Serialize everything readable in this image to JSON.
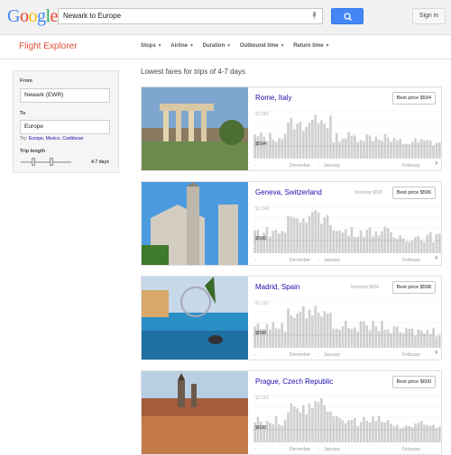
{
  "header": {
    "logo": "Google",
    "search_value": "Newark to Europe",
    "signin_label": "Sign in"
  },
  "subheader": {
    "app_title": "Flight Explorer",
    "filters": [
      "Stops",
      "Airline",
      "Duration",
      "Outbound time",
      "Return time"
    ]
  },
  "sidebar": {
    "from_label": "From",
    "from_value": "Newark (EWR)",
    "to_label": "To",
    "to_value": "Europe",
    "try_label": "Try:",
    "try_links": [
      "Europe,",
      "Mexico,",
      "Caribbean"
    ],
    "trip_length_label": "Trip length",
    "trip_length_value": "4-7 days"
  },
  "results": {
    "title": "Lowest fares for trips of 4-7 days",
    "cards": [
      {
        "city": "Rome, Italy",
        "nonstop": "",
        "best_price": "Best price $594",
        "y_max_label": "$1,882",
        "y_min_label": "$594",
        "x_labels": [
          "December",
          "January",
          "February"
        ]
      },
      {
        "city": "Geneva, Switzerland",
        "nonstop": "Nonstop $836",
        "best_price": "Best price $596",
        "y_max_label": "$1,546",
        "y_min_label": "$596",
        "x_labels": [
          "December",
          "January",
          "February"
        ]
      },
      {
        "city": "Madrid, Spain",
        "nonstop": "Nonstop $826",
        "best_price": "Best price $598",
        "y_max_label": "$2,181",
        "y_min_label": "$598",
        "x_labels": [
          "December",
          "January",
          "February"
        ]
      },
      {
        "city": "Prague, Czech Republic",
        "nonstop": "",
        "best_price": "Best price $600",
        "y_max_label": "$1,582",
        "y_min_label": "$600",
        "x_labels": [
          "December",
          "January",
          "February"
        ]
      }
    ]
  },
  "colors": {
    "accent": "#dd4b39",
    "link": "#1a0dab",
    "search_button": "#4486f6"
  }
}
